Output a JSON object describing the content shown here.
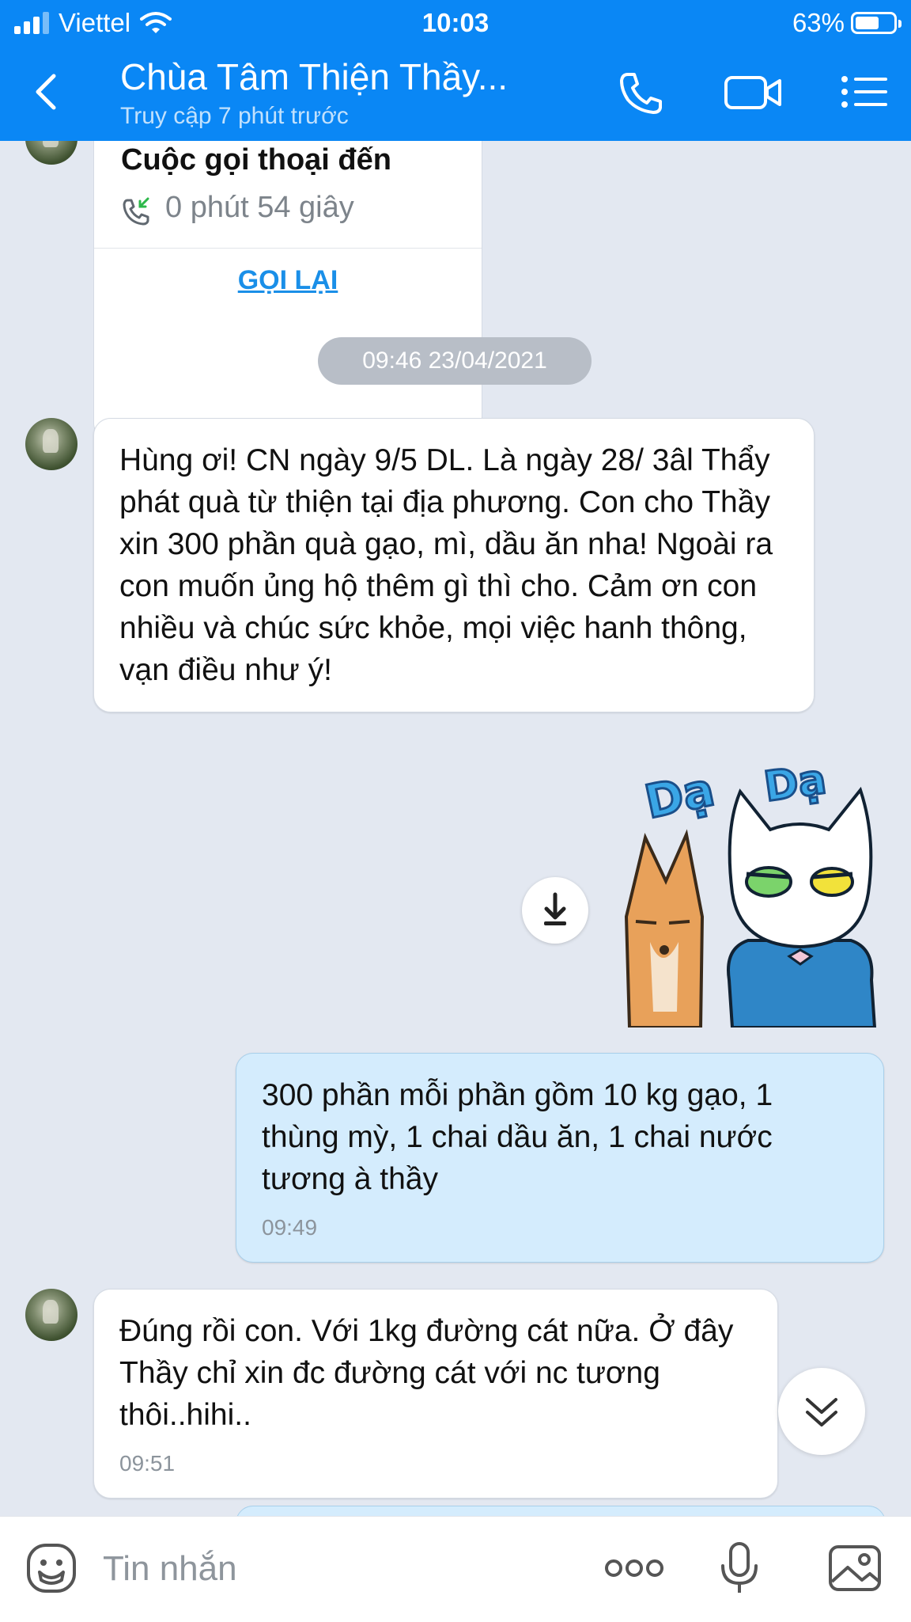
{
  "status_bar": {
    "carrier": "Viettel",
    "time": "10:03",
    "battery": "63%",
    "battery_level": 0.63
  },
  "header": {
    "title": "Chùa Tâm Thiện Thầy...",
    "subtitle": "Truy cập 7 phút trước"
  },
  "call_card": {
    "title": "Cuộc gọi thoại đến",
    "duration": "0 phút 54 giây",
    "callback_label": "GỌI LẠI"
  },
  "time_separator": "09:46 23/04/2021",
  "messages": [
    {
      "sender": "other",
      "text": "Hùng ơi! CN ngày 9/5 DL. Là ngày 28/ 3âl Thẩy phát quà từ thiện tại địa phương. Con cho Thầy xin 300 phần quà gạo, mì, dầu ăn nha! Ngoài ra con muốn ủng hộ thêm gì thì cho. Cảm ơn con nhiều và chúc sức khỏe, mọi việc hanh thông, vạn điều như ý!",
      "time": ""
    },
    {
      "sender": "me",
      "text": "300 phần mỗi phần gồm 10 kg gạo, 1 thùng mỳ, 1 chai dầu ăn, 1 chai nước tương à thầy",
      "time": "09:49"
    },
    {
      "sender": "other",
      "text": "Đúng rồi con. Với 1kg đường cát nữa. Ở đây Thầy chỉ xin đc đường cát với nc tương thôi..hihi..",
      "time": "09:51"
    }
  ],
  "sticker": {
    "text_left": "Dạ",
    "text_right": "Dạ"
  },
  "input": {
    "placeholder": "Tin nhắn",
    "value": ""
  },
  "icons": [
    "back-icon",
    "phone-icon",
    "video-call-icon",
    "menu-list-icon",
    "download-icon",
    "scroll-down-icon",
    "emoji-icon",
    "more-icon",
    "microphone-icon",
    "image-icon"
  ],
  "colors": {
    "header": "#0a87f5",
    "background": "#e3e8f1",
    "my_bubble": "#d4ecfd",
    "link": "#1a8fe8"
  }
}
